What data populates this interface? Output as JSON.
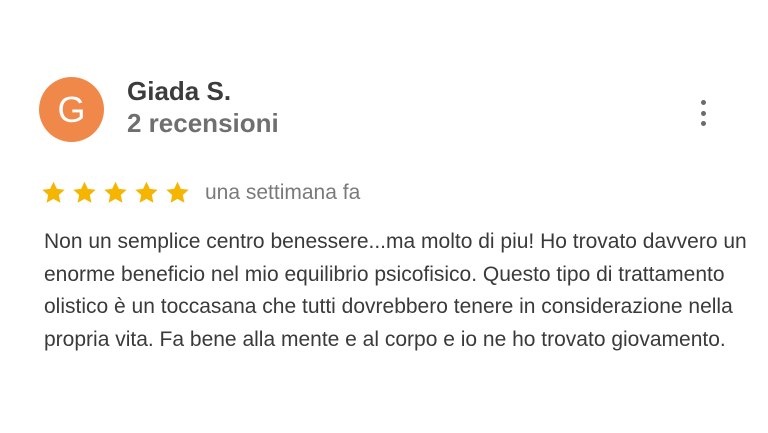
{
  "review": {
    "author": {
      "initial": "G",
      "name": "Giada S.",
      "meta": "2 recensioni",
      "avatar_color": "#f0884a"
    },
    "menu_icon": "more-vert-icon",
    "rating": {
      "value": 5,
      "max": 5,
      "star_color": "#f6b500",
      "star_icon": "star-icon"
    },
    "time_ago": "una settimana fa",
    "text": "Non un semplice centro benessere...ma molto di piu! Ho trovato davvero un enorme beneficio nel mio equilibrio psicofisico. Questo tipo di trattamento olistico è un toccasana che tutti dovrebbero tenere in considerazione nella propria vita. Fa bene alla mente e al corpo e io ne ho trovato giovamento."
  }
}
